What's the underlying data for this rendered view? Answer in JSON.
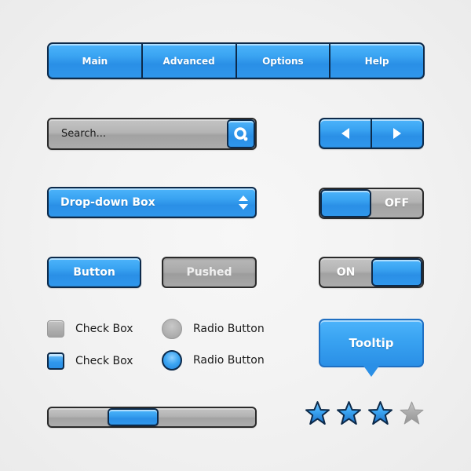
{
  "nav": {
    "tabs": [
      {
        "label": "Main"
      },
      {
        "label": "Advanced"
      },
      {
        "label": "Options"
      },
      {
        "label": "Help"
      }
    ]
  },
  "search": {
    "placeholder": "Search...",
    "value": "",
    "icon": "search-icon"
  },
  "pager": {
    "prev_icon": "triangle-left-icon",
    "next_icon": "triangle-right-icon"
  },
  "dropdown": {
    "selected": "Drop-down Box",
    "icon": "up-down-arrows-icon"
  },
  "toggles": {
    "off": {
      "label": "OFF",
      "state": "off"
    },
    "on": {
      "label": "ON",
      "state": "on"
    }
  },
  "buttons": {
    "normal_label": "Button",
    "pushed_label": "Pushed"
  },
  "checkboxes": [
    {
      "label": "Check Box",
      "checked": false
    },
    {
      "label": "Check Box",
      "checked": true
    }
  ],
  "radios": [
    {
      "label": "Radio Button",
      "selected": false
    },
    {
      "label": "Radio Button",
      "selected": true
    }
  ],
  "tooltip": {
    "text": "Tooltip"
  },
  "slider": {
    "value_fraction": 0.38
  },
  "rating": {
    "value": 3,
    "max": 4
  },
  "colors": {
    "accent": "#3aa4f2",
    "border_dark": "#0d2a4a",
    "grey": "#b0b0b0",
    "star_empty": "#a8a8a8"
  }
}
